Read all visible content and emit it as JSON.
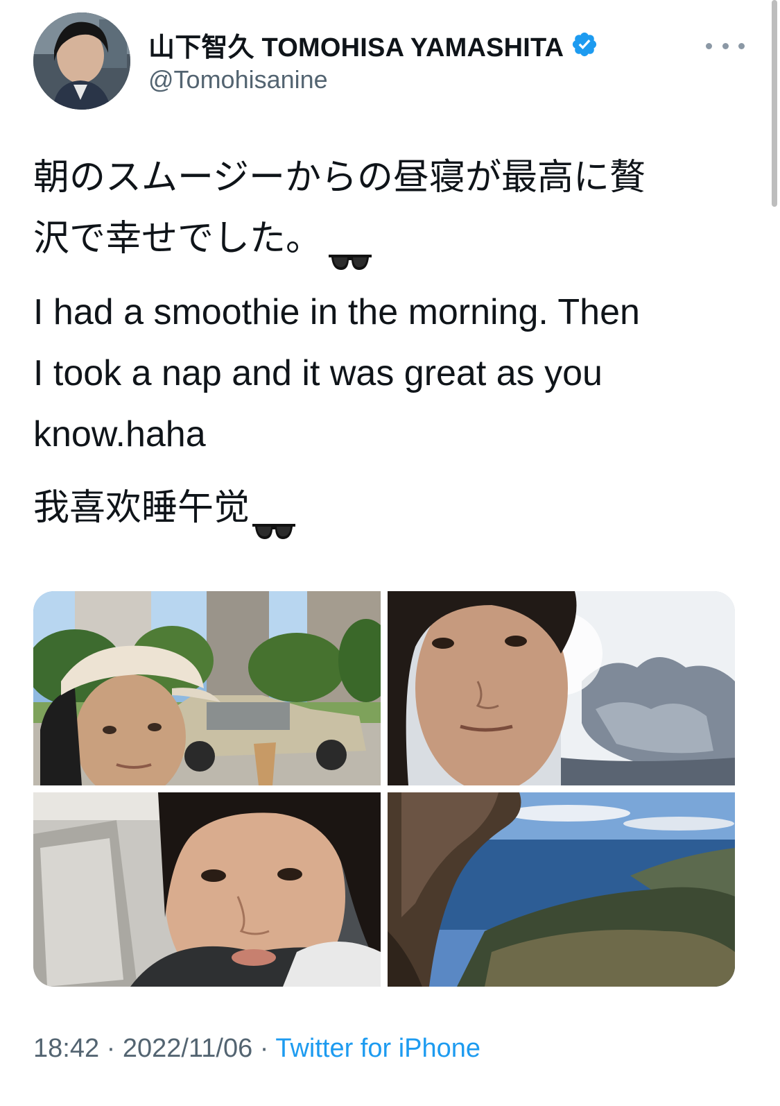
{
  "tweet": {
    "author": {
      "display_name": "山下智久 TOMOHISA YAMASHITA",
      "handle": "@Tomohisanine",
      "verified_icon": "verified-badge-icon",
      "avatar_icon": "profile-avatar"
    },
    "more_icon": "more-options-icon",
    "text": {
      "paragraph_jp_line1": "朝のスムージーからの昼寝が最高に贅",
      "paragraph_jp_line2": "沢で幸せでした。",
      "paragraph_en_line1": "I had a smoothie in the morning. Then",
      "paragraph_en_line2": "I took a nap and it was great as you",
      "paragraph_en_line3": "know.haha",
      "paragraph_zh": "我喜欢睡午觉",
      "emoji": "sunglasses-icon"
    },
    "media": [
      {
        "name": "photo-street-selfie-cap"
      },
      {
        "name": "photo-selfie-sky-clouds"
      },
      {
        "name": "photo-selfie-indoors"
      },
      {
        "name": "photo-coastline-view"
      }
    ],
    "meta": {
      "time": "18:42",
      "separator": " · ",
      "date": "2022/11/06",
      "source": "Twitter for iPhone"
    },
    "colors": {
      "text_primary": "#0f1419",
      "text_secondary": "#536471",
      "link": "#1d9bf0",
      "verified": "#1d9bf0"
    }
  }
}
